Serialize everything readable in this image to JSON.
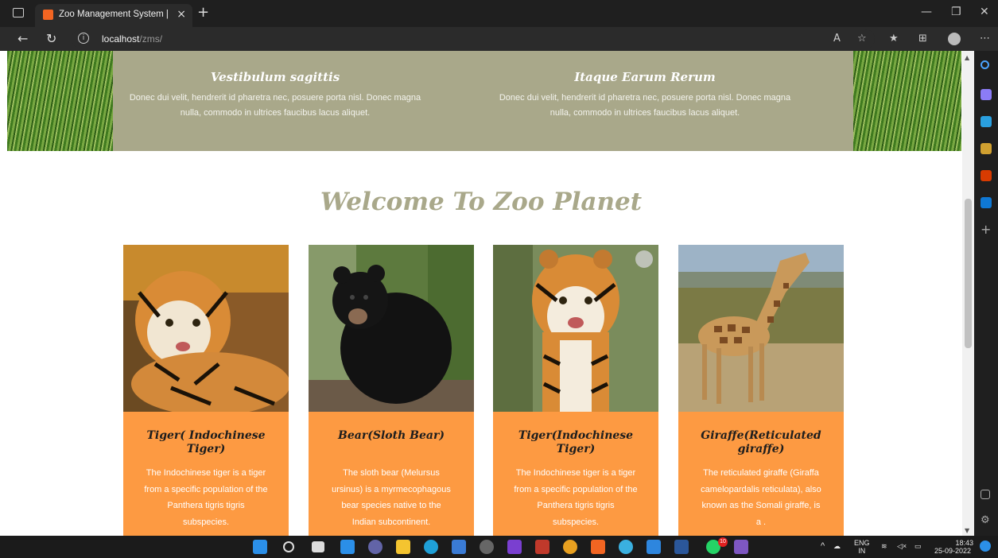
{
  "browser": {
    "tab_title": "Zoo Management System | Hom",
    "tab_close": "×",
    "new_tab": "+",
    "url_host": "localhost",
    "url_path": "/zms/",
    "window_minimize": "—",
    "window_restore": "❐",
    "window_close": "✕"
  },
  "banner": {
    "col1_title": "Vestibulum sagittis",
    "col1_text": "Donec dui velit, hendrerit id pharetra nec, posuere porta nisl. Donec magna nulla, commodo in ultrices faucibus lacus aliquet.",
    "col2_title": "Itaque Earum Rerum",
    "col2_text": "Donec dui velit, hendrerit id pharetra nec, posuere porta nisl. Donec magna nulla, commodo in ultrices faucibus lacus aliquet."
  },
  "welcome_heading": "Welcome To Zoo Planet",
  "cards": [
    {
      "title": "Tiger( Indochinese Tiger)",
      "text": "The Indochinese tiger is a tiger from a specific population of the Panthera tigris tigris subspecies.",
      "image": "tiger-lying"
    },
    {
      "title": "Bear(Sloth Bear)",
      "text": "The sloth bear (Melursus ursinus) is a myrmecophagous bear species native to the Indian subcontinent.",
      "image": "black-bear"
    },
    {
      "title": "Tiger(Indochinese Tiger)",
      "text": "The Indochinese tiger is a tiger from a specific population of the Panthera tigris tigris subspecies.",
      "image": "tiger-standing"
    },
    {
      "title": "Giraffe(Reticulated giraffe)",
      "text": "The reticulated giraffe (Giraffa camelopardalis reticulata), also known as the Somali giraffe, is a .",
      "image": "giraffe"
    }
  ],
  "taskbar": {
    "lang_top": "ENG",
    "lang_bottom": "IN",
    "time": "18:43",
    "date": "25-09-2022",
    "whatsapp_badge": "10"
  },
  "colors": {
    "banner": "#a9a88a",
    "card": "#fd9a42",
    "heading": "#a9a88a"
  }
}
